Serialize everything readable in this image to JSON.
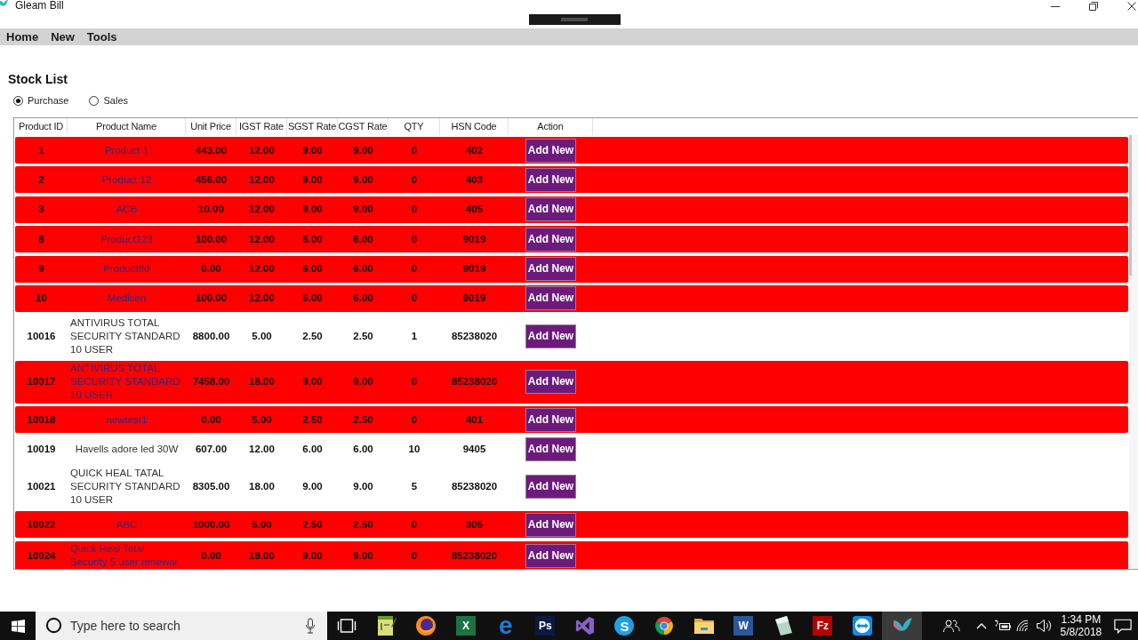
{
  "window": {
    "title": "Gleam Bill"
  },
  "menu": [
    "Home",
    "New",
    "Tools"
  ],
  "page": {
    "title": "Stock List"
  },
  "filter": [
    {
      "label": "Purchase",
      "selected": true
    },
    {
      "label": "Sales",
      "selected": false
    }
  ],
  "table": {
    "columns": [
      "Product ID",
      "Product Name",
      "Unit Price",
      "IGST Rate",
      "SGST Rate",
      "CGST Rate",
      "QTY",
      "HSN Code",
      "Action"
    ],
    "rows": [
      {
        "highlighted": true,
        "cells": [
          "1",
          "Product 1",
          "443.00",
          "12.00",
          "9.00",
          "9.00",
          "0",
          "402"
        ],
        "action": "Add New"
      },
      {
        "highlighted": true,
        "cells": [
          "2",
          "Product 12",
          "456.00",
          "12.00",
          "9.00",
          "9.00",
          "0",
          "403"
        ],
        "action": "Add New"
      },
      {
        "highlighted": true,
        "cells": [
          "3",
          "ACB",
          "10.00",
          "12.00",
          "9.00",
          "9.00",
          "0",
          "405"
        ],
        "action": "Add New"
      },
      {
        "highlighted": true,
        "cells": [
          "8",
          "Product123",
          "100.00",
          "12.00",
          "6.00",
          "6.00",
          "0",
          "9019"
        ],
        "action": "Add New"
      },
      {
        "highlighted": true,
        "cells": [
          "9",
          "Product88",
          "0.00",
          "12.00",
          "6.00",
          "6.00",
          "0",
          "9019"
        ],
        "action": "Add New"
      },
      {
        "highlighted": true,
        "cells": [
          "10",
          "Medicen",
          "100.00",
          "12.00",
          "6.00",
          "6.00",
          "0",
          "9019"
        ],
        "action": "Add New"
      },
      {
        "highlighted": false,
        "cells": [
          "10016",
          "ANTIVIRUS TOTAL SECURITY STANDARD 10 USER",
          "8800.00",
          "5.00",
          "2.50",
          "2.50",
          "1",
          "85238020"
        ],
        "action": "Add New"
      },
      {
        "highlighted": true,
        "cells": [
          "10017",
          "ANTIVIRUS TOTAL SECURITY STANDARD 10 USER",
          "7458.00",
          "18.00",
          "9.00",
          "9.00",
          "0",
          "85238020"
        ],
        "action": "Add New"
      },
      {
        "highlighted": true,
        "cells": [
          "10018",
          "newtest1",
          "0.00",
          "5.00",
          "2.50",
          "2.50",
          "0",
          "401"
        ],
        "action": "Add New"
      },
      {
        "highlighted": false,
        "cells": [
          "10019",
          "Havells adore led 30W",
          "607.00",
          "12.00",
          "6.00",
          "6.00",
          "10",
          "9405"
        ],
        "action": "Add New"
      },
      {
        "highlighted": false,
        "cells": [
          "10021",
          "QUICK HEAL TATAL SECURITY STANDARD 10 USER",
          "8305.00",
          "18.00",
          "9.00",
          "9.00",
          "5",
          "85238020"
        ],
        "action": "Add New"
      },
      {
        "highlighted": true,
        "cells": [
          "10022",
          "ABC",
          "1000.00",
          "5.00",
          "2.50",
          "2.50",
          "0",
          "305"
        ],
        "action": "Add New"
      },
      {
        "highlighted": true,
        "cells": [
          "10024",
          "Quick Heal Total Security 5 user renewal",
          "0.00",
          "18.00",
          "9.00",
          "9.00",
          "0",
          "85238020"
        ],
        "action": "Add New"
      }
    ]
  },
  "taskbar": {
    "search": {
      "placeholder": "Type here to search"
    },
    "apps": [
      {
        "kind": "task-view",
        "selected": false
      },
      {
        "kind": "notepad",
        "selected": false
      },
      {
        "kind": "globe",
        "selected": false
      },
      {
        "kind": "letter-tile",
        "glyph": "X",
        "color": "#1e7145",
        "selected": false
      },
      {
        "kind": "letter",
        "glyph": "e",
        "color": "#1f7bd8",
        "selected": false
      },
      {
        "kind": "letter-tile",
        "glyph": "Ps",
        "color": "#0b1a42",
        "selected": false
      },
      {
        "kind": "loop",
        "selected": false
      },
      {
        "kind": "letter-circle",
        "glyph": "S",
        "color": "#1fa0e6",
        "selected": false
      },
      {
        "kind": "sectors",
        "selected": false
      },
      {
        "kind": "folder",
        "selected": false
      },
      {
        "kind": "letter-tile",
        "glyph": "W",
        "color": "#2b579a",
        "selected": false
      },
      {
        "kind": "sheet",
        "selected": false
      },
      {
        "kind": "letter-tile",
        "glyph": "Fz",
        "color": "#b40000",
        "selected": false
      },
      {
        "kind": "double-arrow",
        "selected": false
      },
      {
        "kind": "bird",
        "selected": true
      }
    ],
    "time": "1:34 PM",
    "date": "5/8/2018"
  }
}
